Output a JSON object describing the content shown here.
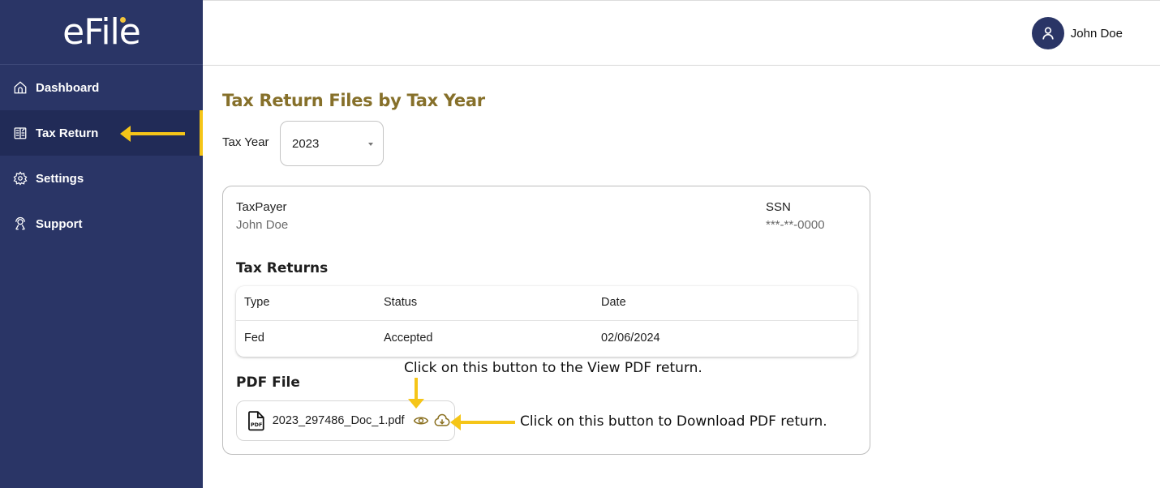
{
  "app": {
    "logo_text": "eFile",
    "brand_color": "#2a3566",
    "accent_color": "#f5c518",
    "title_color": "#86702a"
  },
  "sidebar": {
    "items": [
      {
        "label": "Dashboard",
        "icon": "home-icon",
        "active": false
      },
      {
        "label": "Tax Return",
        "icon": "tax-return-icon",
        "active": true
      },
      {
        "label": "Settings",
        "icon": "gear-icon",
        "active": false
      },
      {
        "label": "Support",
        "icon": "support-icon",
        "active": false
      }
    ]
  },
  "header": {
    "user_name": "John Doe",
    "avatar_icon": "user-icon"
  },
  "main": {
    "page_title": "Tax Return Files by Tax Year",
    "tax_year_label": "Tax Year",
    "tax_year_selected": "2023",
    "taxpayer": {
      "label": "TaxPayer",
      "value": "John Doe"
    },
    "ssn": {
      "label": "SSN",
      "value": "***-**-0000"
    },
    "tax_returns_title": "Tax Returns",
    "table": {
      "columns": [
        "Type",
        "Status",
        "Date"
      ],
      "rows": [
        [
          "Fed",
          "Accepted",
          "02/06/2024"
        ]
      ]
    },
    "pdf_section_title": "PDF File",
    "pdf_file": {
      "name": "2023_297486_Doc_1.pdf",
      "view_icon": "eye-icon",
      "download_icon": "cloud-download-icon"
    }
  },
  "annotations": {
    "view_hint": "Click on this button to the View PDF return.",
    "download_hint": "Click on this button to Download PDF return."
  }
}
